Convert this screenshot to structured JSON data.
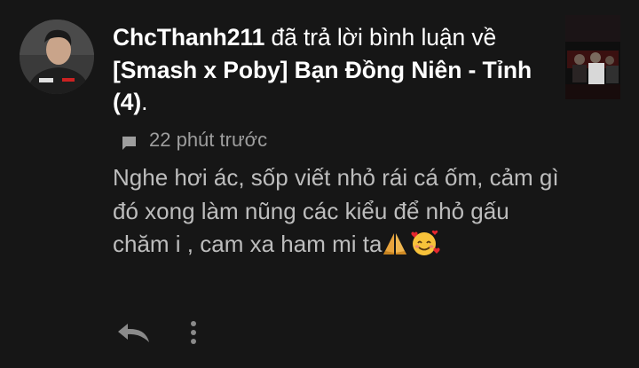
{
  "notification": {
    "avatar_icon": "user-avatar-photo",
    "thumbnail_icon": "video-thumbnail",
    "username": "ChcThanh211",
    "action_text": " đã trả lời bình luận về ",
    "video_title": "[Smash x Poby] Bạn Đồng Niên - Tỉnh (4)",
    "title_end": ".",
    "time_icon": "comment-icon",
    "time_ago": "22 phút trước",
    "comment_text": "Nghe hơi ác, sốp viết nhỏ rái cá ốm, cảm gì đó xong làm nũng các kiểu để nhỏ gấu chăm i , cam xa ham mi ta",
    "emojis": [
      "folded-hands-emoji",
      "smiling-face-with-hearts-emoji"
    ],
    "reply_icon": "reply-icon",
    "more_icon": "more-vertical-icon"
  },
  "colors": {
    "background": "#161616",
    "primary_text": "#ffffff",
    "comment_text": "#bdbdbd",
    "secondary_text": "#9e9e9e",
    "icon": "#9e9e9e"
  }
}
